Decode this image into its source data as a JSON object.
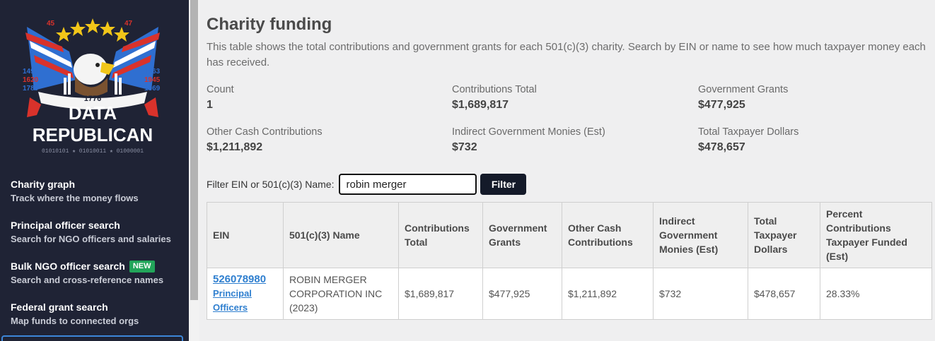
{
  "logo": {
    "alt": "Data Republican logo",
    "numbers_top": [
      "45",
      "47"
    ],
    "numbers_left": [
      "1492",
      "1620",
      "1789"
    ],
    "numbers_right": [
      "1863",
      "1945",
      "1969"
    ],
    "banner_year": "1776",
    "line1": "DATA",
    "line2": "REPUBLICAN",
    "binary": "01010101 ★ 01010011 ★ 01000001",
    "colors": {
      "red": "#d9322b",
      "blue": "#2f6fd1",
      "gold": "#f2c619",
      "bg": "#1f2335"
    }
  },
  "sidebar": {
    "items": [
      {
        "title": "Charity graph",
        "subtitle": "Track where the money flows"
      },
      {
        "title": "Principal officer search",
        "subtitle": "Search for NGO officers and salaries"
      },
      {
        "title": "Bulk NGO officer search",
        "badge": "NEW",
        "subtitle": "Search and cross-reference names"
      },
      {
        "title": "Federal grant search",
        "subtitle": "Map funds to connected orgs"
      }
    ]
  },
  "main": {
    "title": "Charity funding",
    "description": "This table shows the total contributions and government grants for each 501(c)(3) charity. Search by EIN or name to see how much taxpayer money each has received.",
    "stats": [
      {
        "label": "Count",
        "value": "1"
      },
      {
        "label": "Contributions Total",
        "value": "$1,689,817"
      },
      {
        "label": "Government Grants",
        "value": "$477,925"
      },
      {
        "label": "Other Cash Contributions",
        "value": "$1,211,892"
      },
      {
        "label": "Indirect Government Monies (Est)",
        "value": "$732"
      },
      {
        "label": "Total Taxpayer Dollars",
        "value": "$478,657"
      }
    ],
    "filter": {
      "label": "Filter EIN or 501(c)(3) Name:",
      "value": "robin merger",
      "button": "Filter"
    },
    "table": {
      "headers": [
        "EIN",
        "501(c)(3) Name",
        "Contributions Total",
        "Government Grants",
        "Other Cash Contributions",
        "Indirect Government Monies (Est)",
        "Total Taxpayer Dollars",
        "Percent Contributions Taxpayer Funded (Est)"
      ],
      "rows": [
        {
          "ein": "526078980",
          "officers_link": "Principal Officers",
          "name": "ROBIN MERGER CORPORATION INC (2023)",
          "contributions_total": "$1,689,817",
          "government_grants": "$477,925",
          "other_cash": "$1,211,892",
          "indirect": "$732",
          "total_taxpayer": "$478,657",
          "percent": "28.33%"
        }
      ]
    }
  }
}
